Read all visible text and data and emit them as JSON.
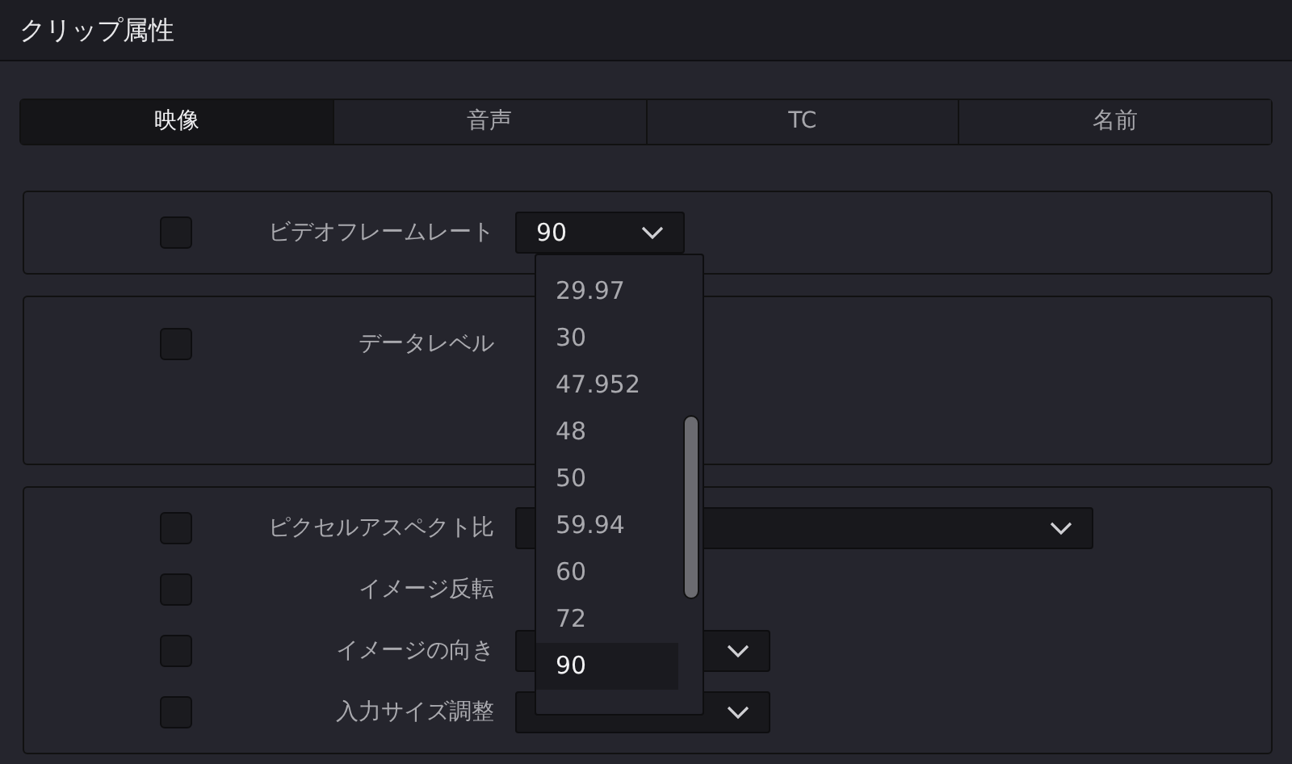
{
  "title": "クリップ属性",
  "tabs": [
    {
      "label": "映像",
      "selected": true
    },
    {
      "label": "音声",
      "selected": false
    },
    {
      "label": "TC",
      "selected": false
    },
    {
      "label": "名前",
      "selected": false
    }
  ],
  "panels": [
    {
      "rows": [
        {
          "label": "ビデオフレームレート",
          "checked": false,
          "kind": "select",
          "value": "90"
        }
      ]
    },
    {
      "rows": [
        {
          "label": "データレベル",
          "checked": false,
          "kind": "none"
        }
      ]
    },
    {
      "rows": [
        {
          "label": "ピクセルアスペクト比",
          "checked": false,
          "kind": "select-wide"
        },
        {
          "label": "イメージ反転",
          "checked": false,
          "kind": "none"
        },
        {
          "label": "イメージの向き",
          "checked": false,
          "kind": "select"
        },
        {
          "label": "入力サイズ調整",
          "checked": false,
          "kind": "select"
        }
      ]
    }
  ],
  "dropdown_list": {
    "items": [
      {
        "label": "29.97",
        "selected": false
      },
      {
        "label": "30",
        "selected": false
      },
      {
        "label": "47.952",
        "selected": false
      },
      {
        "label": "48",
        "selected": false
      },
      {
        "label": "50",
        "selected": false
      },
      {
        "label": "59.94",
        "selected": false
      },
      {
        "label": "60",
        "selected": false
      },
      {
        "label": "72",
        "selected": false
      },
      {
        "label": "90",
        "selected": true
      }
    ]
  }
}
